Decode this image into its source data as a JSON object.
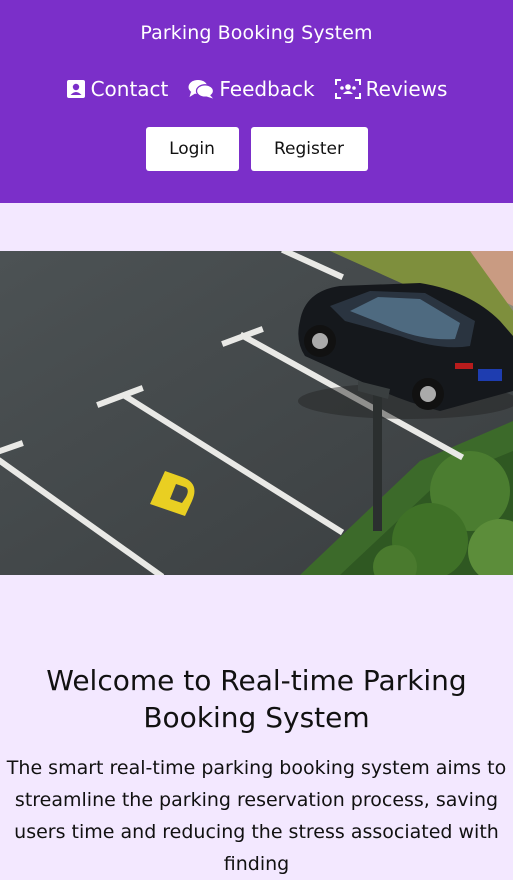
{
  "header": {
    "title": "Parking Booking System",
    "nav": [
      {
        "label": "Contact",
        "icon": "contact-card-icon"
      },
      {
        "label": "Feedback",
        "icon": "chat-bubbles-icon"
      },
      {
        "label": "Reviews",
        "icon": "users-reviews-icon"
      }
    ],
    "login_label": "Login",
    "register_label": "Register"
  },
  "hero": {
    "alt": "Parking lot with a black car and a yellow P marking"
  },
  "main": {
    "welcome_title": "Welcome to Real-time Parking Booking System",
    "description": "The smart real-time parking booking system aims to streamline the parking reservation process, saving users time and reducing the stress associated with finding"
  },
  "colors": {
    "header_bg": "#7b2fc9",
    "page_bg": "#f3e8ff",
    "button_bg": "#ffffff"
  }
}
